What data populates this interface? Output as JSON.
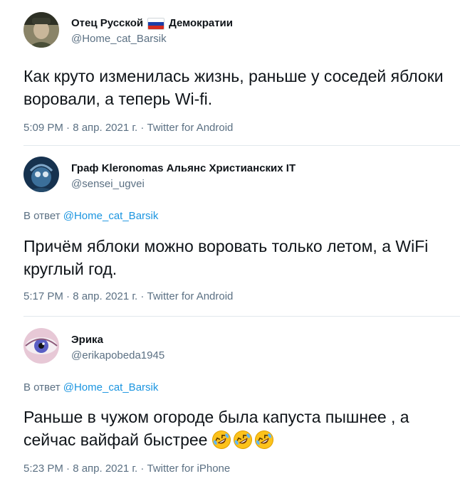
{
  "tweets": [
    {
      "display_name_prefix": "Отец Русской",
      "display_name_suffix": "Демократии",
      "flag_icon": "russia-flag-icon",
      "flag_colors": [
        "#ffffff",
        "#1c3fa8",
        "#d52b1e"
      ],
      "handle": "@Home_cat_Barsik",
      "text": "Как круто изменилась жизнь, раньше у соседей яблоки воровали, а теперь Wi-fi.",
      "meta": "5:09 PM · 8 апр. 2021 г. · Twitter for Android"
    },
    {
      "display_name": "Граф Kleronomas Альянс Христианских IT",
      "handle": "@sensei_ugvei",
      "reply_prefix": "В ответ",
      "reply_mention": "@Home_cat_Barsik",
      "text": "Причём яблоки можно воровать только летом, а WiFi круглый год.",
      "meta": "5:17 PM · 8 апр. 2021 г. · Twitter for Android"
    },
    {
      "display_name": "Эрика",
      "handle": "@erikapobeda1945",
      "reply_prefix": "В ответ",
      "reply_mention": "@Home_cat_Barsik",
      "text": "Раньше в чужом огороде была капуста пышнее , а сейчас вайфай быстрее",
      "emoji_icon": "rolling-on-floor-laughing-icon",
      "emoji_count": 3,
      "meta": "5:23 PM · 8 апр. 2021 г. · Twitter for iPhone"
    }
  ],
  "colors": {
    "text": "#0f1419",
    "secondary": "#5b7083",
    "mention": "#1b95e0",
    "divider": "#e1e8ed"
  }
}
